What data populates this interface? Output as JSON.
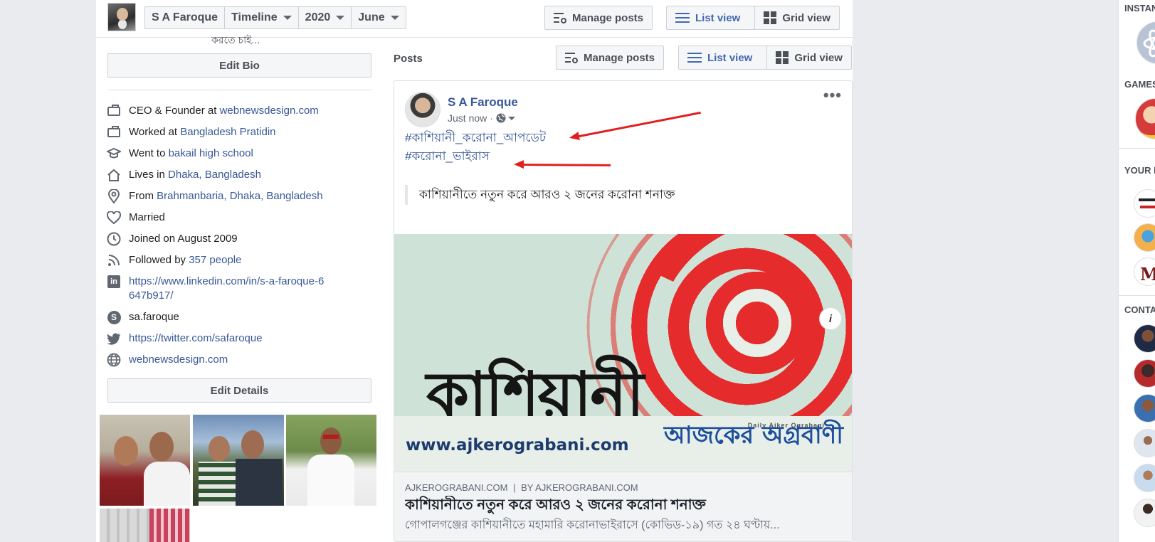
{
  "topbar": {
    "profile_name": "S A Faroque",
    "crumb_timeline": "Timeline",
    "crumb_year": "2020",
    "crumb_month": "June",
    "manage_posts": "Manage posts",
    "list_view": "List view",
    "grid_view": "Grid view"
  },
  "intro": {
    "bio_tail": "করতে চাই...",
    "edit_bio": "Edit Bio",
    "rows": {
      "work1_prefix": "CEO & Founder at ",
      "work1_link": "webnewsdesign.com",
      "work2_prefix": "Worked at ",
      "work2_link": "Bangladesh Pratidin",
      "edu_prefix": "Went to ",
      "edu_link": "bakail high school",
      "lives_prefix": "Lives in ",
      "lives_link": "Dhaka, Bangladesh",
      "from_prefix": "From ",
      "from_link": "Brahmanbaria, Dhaka, Bangladesh",
      "relationship": "Married",
      "joined": "Joined on August 2009",
      "followed_prefix": "Followed by ",
      "followed_link": "357 people",
      "linkedin": "https://www.linkedin.com/in/s-a-faroque-6647b917/",
      "skype": "sa.faroque",
      "twitter": "https://twitter.com/safaroque",
      "website": "webnewsdesign.com"
    },
    "edit_details": "Edit Details"
  },
  "posts": {
    "label": "Posts",
    "manage_posts": "Manage posts",
    "list_view": "List view",
    "grid_view": "Grid view"
  },
  "post": {
    "author": "S A Faroque",
    "time": "Just now",
    "more": "•••",
    "hashtag1": "#কাশিয়ানী_করোনা_আপডেট",
    "hashtag2": "#করোনা_ভাইরাস",
    "quote": "কাশিয়ানীতে নতুন করে আরও ২ জনের করোনা শনাক্ত",
    "image": {
      "big_word": "কাশিয়ানী",
      "url": "www.ajkerograbani.com",
      "brand_small": "Daily Ajker Ograbani",
      "brand": "আজকের অগ্রবাণী",
      "info": "i"
    },
    "link_domain": "AJKEROGRABANI.COM",
    "link_by": "BY AJKEROGRABANI.COM",
    "link_title": "কাশিয়ানীতে নতুন করে আরও ২ জনের করোনা শনাক্ত",
    "link_desc": "গোপালগঞ্জের কাশিয়ানীতে মহামারি করোনাভাইরাসে (কোভিড-১৯) গত ২৪ ঘণ্টায়..."
  },
  "rail": {
    "instant": "INSTANT GAMES",
    "games": "GAMES",
    "your": "YOUR PAGES",
    "contacts": "CONTACTS"
  },
  "colors": {
    "link": "#385898",
    "accent": "#4267b2",
    "annotation_arrow": "#e02020"
  }
}
